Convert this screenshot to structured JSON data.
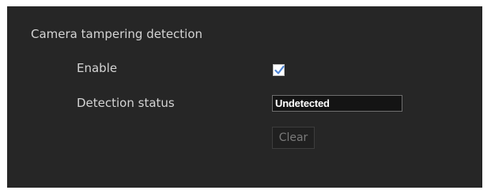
{
  "section": {
    "title": "Camera tampering detection"
  },
  "enable": {
    "label": "Enable",
    "checked": true,
    "accent_color": "#5b8fd9"
  },
  "detection_status": {
    "label": "Detection status",
    "value": "Undetected"
  },
  "clear_button": {
    "label": "Clear",
    "enabled": false
  }
}
